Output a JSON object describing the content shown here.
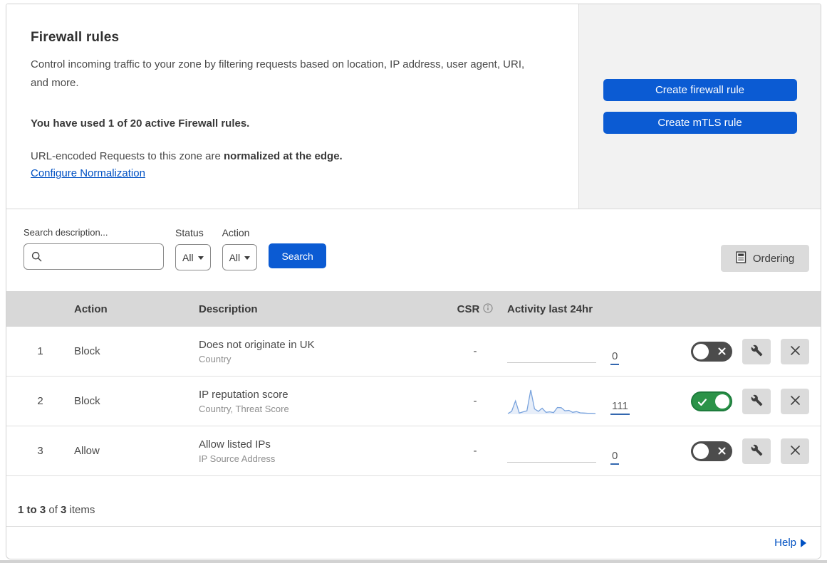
{
  "header": {
    "title": "Firewall rules",
    "description": "Control incoming traffic to your zone by filtering requests based on location, IP address, user agent, URI, and more.",
    "usage_notice": "You have used 1 of 20 active Firewall rules.",
    "normalization_prefix": "URL-encoded Requests to this zone are ",
    "normalization_bold": "normalized at the edge.",
    "normalization_link": "Configure Normalization",
    "create_firewall_button": "Create firewall rule",
    "create_mtls_button": "Create mTLS rule"
  },
  "filters": {
    "search_label": "Search description...",
    "search_value": "",
    "status_label": "Status",
    "status_value": "All",
    "action_label": "Action",
    "action_value": "All",
    "search_button": "Search",
    "ordering_button": "Ordering"
  },
  "table": {
    "columns": {
      "action": "Action",
      "description": "Description",
      "csr": "CSR",
      "activity": "Activity last 24hr"
    },
    "rows": [
      {
        "priority": "1",
        "action": "Block",
        "description": "Does not originate in UK",
        "fields": "Country",
        "csr": "-",
        "activity_count": "0",
        "enabled": false,
        "sparkline_values": null
      },
      {
        "priority": "2",
        "action": "Block",
        "description": "IP reputation score",
        "fields": "Country, Threat Score",
        "csr": "-",
        "activity_count": "111",
        "enabled": true,
        "sparkline_values": [
          3,
          12,
          55,
          5,
          10,
          14,
          100,
          22,
          12,
          25,
          8,
          10,
          7,
          28,
          27,
          14,
          16,
          8,
          11,
          6,
          5,
          4,
          4,
          3
        ]
      },
      {
        "priority": "3",
        "action": "Allow",
        "description": "Allow listed IPs",
        "fields": "IP Source Address",
        "csr": "-",
        "activity_count": "0",
        "enabled": false,
        "sparkline_values": null
      }
    ]
  },
  "footer": {
    "count_bold_start": "1 to 3",
    "count_of": " of ",
    "count_total": "3",
    "count_items": " items",
    "help_label": "Help"
  },
  "colors": {
    "primary_button": "#0b5bd3",
    "link_blue": "#0051c3",
    "toggle_on_green": "#2b9348",
    "toggle_off_gray": "#4c4c4c",
    "sparkline_blue": "#79a3dd",
    "table_header_bg": "#d8d8d8",
    "panel_gray": "#f2f2f2"
  }
}
